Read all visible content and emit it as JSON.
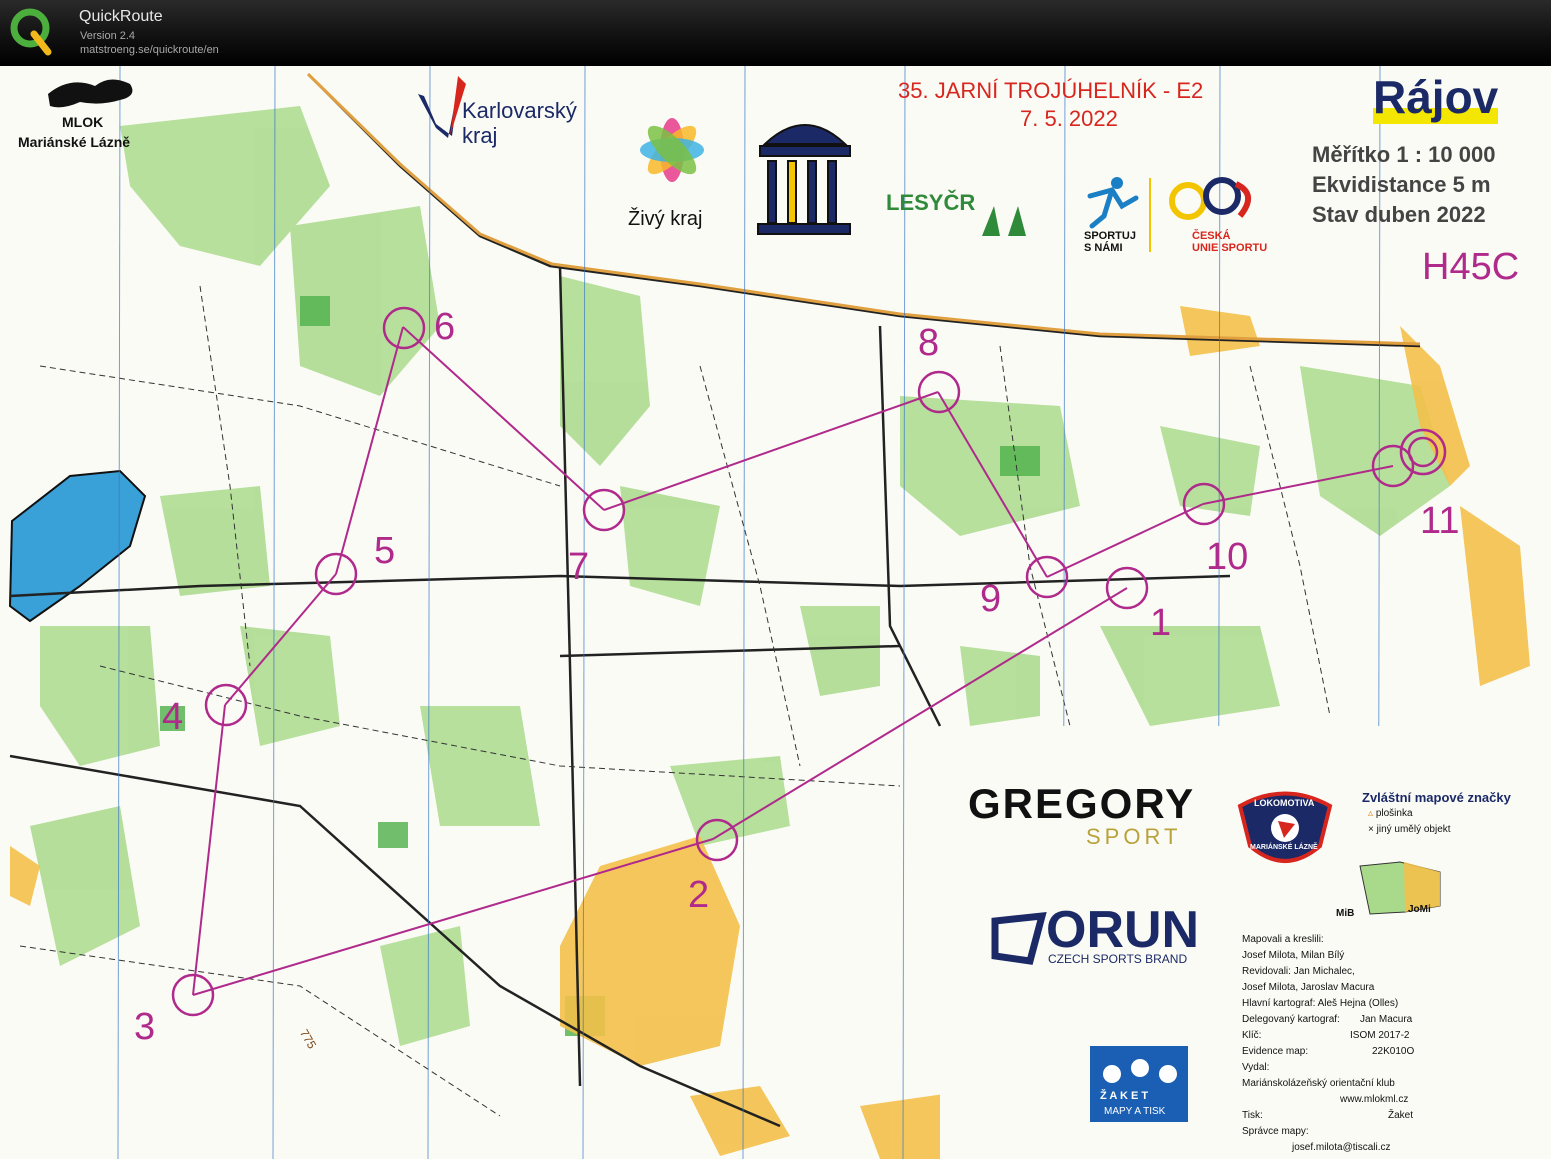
{
  "app": {
    "name": "QuickRoute",
    "version": "Version 2.4",
    "url": "matstroeng.se/quickroute/en"
  },
  "map": {
    "event_title": "35. JARNÍ TROJÚHELNÍK - E2",
    "event_date": "7. 5. 2022",
    "map_name": "Rájov",
    "scale": "Měřítko  1 : 10 000",
    "contour": "Ekvidistance   5 m",
    "status": "Stav    duben 2022",
    "category": "H45C",
    "sponsor_mlok_line1": "MLOK",
    "sponsor_mlok_line2": "Mariánské  Lázně",
    "sponsor_karlovarsky_line1": "Karlovarský",
    "sponsor_karlovarsky_line2": "kraj",
    "sponsor_zivy": "Živý kraj",
    "sponsor_lesy": "LESYČR",
    "sponsor_sportuj_line1": "SPORTUJ",
    "sponsor_sportuj_line2": "S NÁMI",
    "sponsor_cus_line1": "ČESKÁ",
    "sponsor_cus_line2": "UNIE SPORTU",
    "sponsor_gregory": "GREGORY",
    "sponsor_gregory_sub": "SPORT",
    "sponsor_orun": "ORUN",
    "sponsor_orun_sub": "CZECH SPORTS BRAND",
    "sponsor_lokomotiva_top": "LOKOMOTIVA",
    "sponsor_lokomotiva_bottom": "MARIÁNSKÉ LÁZNĚ",
    "sponsor_zaket": "Ž A K E T",
    "sponsor_zaket_sub": "MAPY A TISK",
    "legend_title": "Zvláštní mapové značky",
    "legend_item1": "plošinka",
    "legend_item2": "jiný umělý objekt",
    "inset_label1": "MiB",
    "inset_label2": "JoMi",
    "contour_label": "775",
    "credits": {
      "l1": "Mapovali a kreslili:",
      "l2": "Josef Milota, Milan Bílý",
      "l3": "Revidovali: Jan Michalec,",
      "l4": "Josef Milota, Jaroslav Macura",
      "l5": "Hlavní kartograf: Aleš Hejna (Olles)",
      "l6a": "Delegovaný kartograf:",
      "l6b": "Jan Macura",
      "l7a": "Klíč:",
      "l7b": "ISOM 2017-2",
      "l8a": "Evidence map:",
      "l8b": "22K010O",
      "l9": "Vydal:",
      "l10": "Mariánskolázeňský orientační klub",
      "l11": "www.mlokml.cz",
      "l12a": "Tisk:",
      "l12b": "Žaket",
      "l13": "Správce mapy:",
      "l14": "josef.milota@tiscali.cz"
    },
    "controls": [
      "1",
      "2",
      "3",
      "4",
      "5",
      "6",
      "7",
      "8",
      "9",
      "10",
      "11"
    ],
    "colors": {
      "course": "#b02a8c",
      "forest_green": "#a8d98a",
      "open_yellow": "#f5c04a",
      "water_blue": "#3aa0d8",
      "event_red": "#d7261e",
      "mapname_navy": "#1b2a66"
    }
  }
}
